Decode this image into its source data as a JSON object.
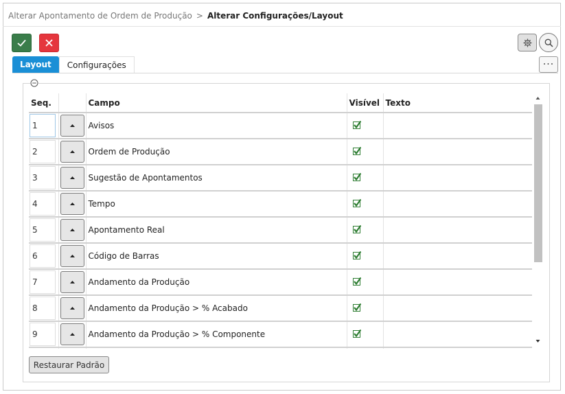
{
  "breadcrumb": {
    "parent": "Alterar Apontamento de Ordem de Produção",
    "separator": ">",
    "current": "Alterar Configurações/Layout"
  },
  "toolbar": {
    "confirm_icon": "check-icon",
    "cancel_icon": "close-icon",
    "settings_icon": "gear-icon",
    "search_icon": "search-icon",
    "more_label": "···"
  },
  "tabs": [
    {
      "label": "Layout",
      "active": true
    },
    {
      "label": "Configurações",
      "active": false
    }
  ],
  "table": {
    "columns": [
      "Seq.",
      "",
      "Campo",
      "Visível",
      "Texto"
    ],
    "rows": [
      {
        "seq": "1",
        "campo": "Avisos",
        "visivel": true,
        "texto": ""
      },
      {
        "seq": "2",
        "campo": "Ordem de Produção",
        "visivel": true,
        "texto": ""
      },
      {
        "seq": "3",
        "campo": "Sugestão de Apontamentos",
        "visivel": true,
        "texto": ""
      },
      {
        "seq": "4",
        "campo": "Tempo",
        "visivel": true,
        "texto": ""
      },
      {
        "seq": "5",
        "campo": "Apontamento Real",
        "visivel": true,
        "texto": ""
      },
      {
        "seq": "6",
        "campo": "Código de Barras",
        "visivel": true,
        "texto": ""
      },
      {
        "seq": "7",
        "campo": "Andamento da Produção",
        "visivel": true,
        "texto": ""
      },
      {
        "seq": "8",
        "campo": "Andamento da Produção > % Acabado",
        "visivel": true,
        "texto": ""
      },
      {
        "seq": "9",
        "campo": "Andamento da Produção > % Componente",
        "visivel": true,
        "texto": ""
      },
      {
        "seq": "",
        "campo": "",
        "visivel": true,
        "texto": ""
      }
    ]
  },
  "restore_button": "Restaurar Padrão",
  "colors": {
    "accent": "#1a8fd6",
    "confirm": "#3a7d4a",
    "cancel": "#e5363d",
    "check": "#2e7d32"
  }
}
